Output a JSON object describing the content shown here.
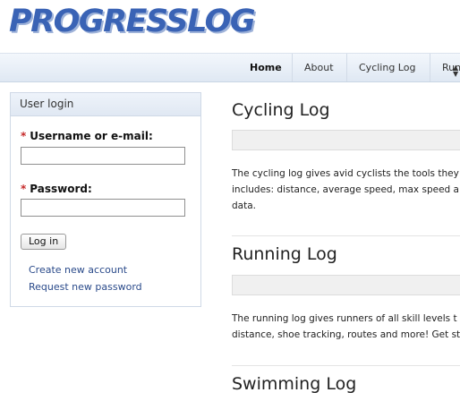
{
  "site": {
    "logo_text": "PROGRESSLOG"
  },
  "nav": {
    "items": [
      {
        "label": "Home",
        "active": true
      },
      {
        "label": "About",
        "active": false
      },
      {
        "label": "Cycling Log",
        "active": false
      },
      {
        "label": "Run",
        "active": false
      }
    ]
  },
  "login": {
    "title": "User login",
    "username_label": "Username or e-mail:",
    "password_label": "Password:",
    "required_marker": "*",
    "username_value": "",
    "password_value": "",
    "submit_label": "Log in",
    "create_account": "Create new account",
    "request_password": "Request new password"
  },
  "sections": [
    {
      "title": "Cycling Log",
      "lines": [
        "The cycling log gives avid cyclists the tools they",
        "includes: distance, average speed, max speed a",
        "data."
      ]
    },
    {
      "title": "Running Log",
      "lines": [
        "The running log gives runners of all skill levels t",
        "distance, shoe tracking, routes and more! Get st"
      ]
    },
    {
      "title": "Swimming Log",
      "lines": []
    }
  ],
  "colors": {
    "logo": "#3a63b5",
    "link": "#2a4a8a",
    "required": "#c62a2a",
    "nav_bg": "#e6edf6"
  },
  "icons": {
    "nav_overflow": "scroll-arrow-icon"
  }
}
